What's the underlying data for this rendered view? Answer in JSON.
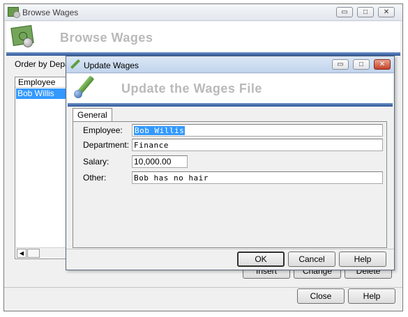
{
  "outer_window": {
    "title": "Browse Wages",
    "banner_title": "Browse Wages",
    "order_by_label": "Order by Depar",
    "list": {
      "header": "Employee",
      "rows": [
        "Bob Willis"
      ]
    },
    "buttons": {
      "insert": "Insert",
      "change": "Change",
      "delete": "Delete",
      "close": "Close",
      "help": "Help"
    },
    "caption": {
      "minimize": "▭",
      "maximize": "□",
      "close": "✕"
    }
  },
  "inner_window": {
    "title": "Update Wages",
    "banner_title": "Update the Wages File",
    "tab": "General",
    "fields": {
      "employee": {
        "label": "Employee:",
        "value": "Bob Willis"
      },
      "department": {
        "label": "Department:",
        "value": "Finance"
      },
      "salary": {
        "label": "Salary:",
        "value": "10,000.00"
      },
      "other": {
        "label": "Other:",
        "value": "Bob has no hair"
      }
    },
    "buttons": {
      "ok": "OK",
      "cancel": "Cancel",
      "help": "Help"
    },
    "caption": {
      "minimize": "▭",
      "maximize": "□",
      "close": "✕"
    }
  },
  "colors": {
    "selection": "#3399ff",
    "banner_rule": "#2d5597",
    "banner_text": "#b9b9b9",
    "close_button": "#c4422a"
  }
}
